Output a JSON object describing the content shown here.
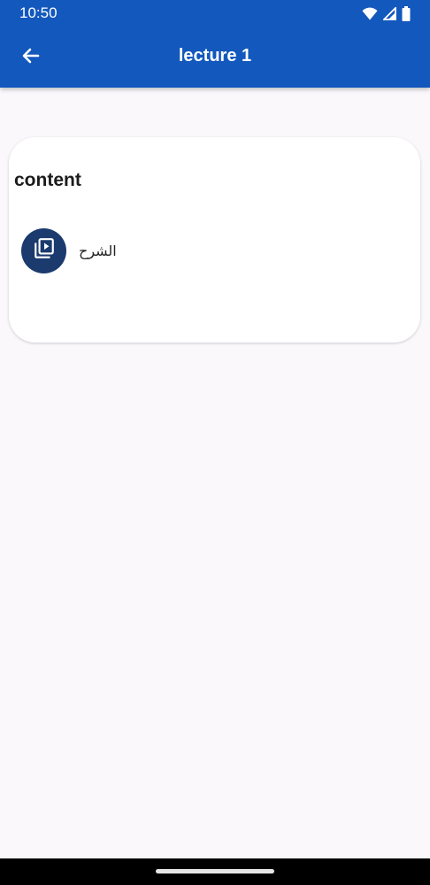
{
  "status_bar": {
    "time": "10:50",
    "icons": [
      "wifi-icon",
      "cell-signal-icon",
      "battery-icon"
    ]
  },
  "app_bar": {
    "title": "lecture 1",
    "back_icon": "arrow-left-icon",
    "color": "#1358bd"
  },
  "content_card": {
    "title": "content",
    "items": [
      {
        "label": "الشرح",
        "icon": "video-library-icon"
      }
    ]
  },
  "colors": {
    "accent": "#1358bd",
    "avatar": "#1b3a6e",
    "background": "#fbf8fc"
  }
}
